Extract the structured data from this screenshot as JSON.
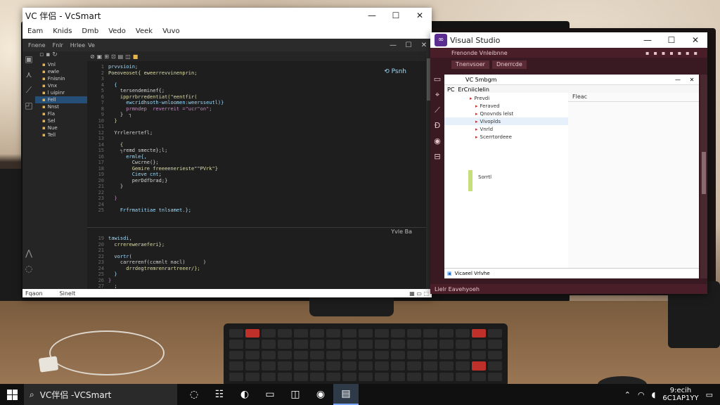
{
  "vcsmart": {
    "title": "VC 伴侣 - VcSmart",
    "menu": [
      "Eam",
      "Knids",
      "Dmb",
      "Vedo",
      "Veek",
      "Vuvo"
    ],
    "window_buttons": [
      "—",
      "☐",
      "✕"
    ],
    "ide_head": [
      "Fnene",
      "Fnlr",
      "Hrlee",
      "Ve"
    ],
    "explorer_rows": [
      {
        "label": "Vnl",
        "sel": false
      },
      {
        "label": "ewle",
        "sel": false
      },
      {
        "label": "Fnisnin",
        "sel": false
      },
      {
        "label": "Vnx",
        "sel": false
      },
      {
        "label": "l uipinr",
        "sel": false
      },
      {
        "label": "Fell",
        "sel": true
      },
      {
        "label": "Nnst",
        "sel": false
      },
      {
        "label": "Fla",
        "sel": false
      },
      {
        "label": "Sel",
        "sel": false
      },
      {
        "label": "Nue",
        "sel": false
      },
      {
        "label": "Tell",
        "sel": false
      }
    ],
    "gutter_top": [
      "1",
      "2",
      "3",
      "4",
      "5",
      "6",
      "7",
      "8",
      "9",
      "10",
      "11",
      "12",
      "13",
      "14",
      "15",
      "16",
      "17",
      "18",
      "19",
      "20",
      "21",
      "22",
      "23",
      "24",
      "25",
      "26"
    ],
    "code_lines": [
      "prvvsioin;",
      "Poeoveoset{ eweerrevvinenprin;",
      "",
      "  {",
      "    tersendeminef{;",
      "    ipprrbrredentiat(\"eentfir(",
      "      ewcridhsoth-wnloomen:weersseutl)}",
      "      prmndep  reverreit =\"ucr\"on\";",
      "    }  ┐",
      "  }",
      "",
      "  Yrrlerertefl;",
      "",
      "    {",
      "    ┐remd smecte};l;",
      "      ermle{,",
      "        Cwcrne(};",
      "        Gemire freeeenerieste\"\"PVrk\"}",
      "        Cieve cnt;",
      "        perDdfbrad;}",
      "    }",
      "",
      "  }",
      "",
      "    Frfrmatitiae tnlsamet.};"
    ],
    "search_hint": "Psnh",
    "panel_tabs": "Yvle  Ba",
    "panel_lines": [
      "tawisdi,",
      "  crrereweraeferi};",
      "",
      "  vortr(",
      "    carrerenf(ccmnlt nacl)      )",
      "      drrdegtremrenrartreeer/};",
      "  }",
      "}",
      "  ;"
    ],
    "panel_gutter": [
      "19",
      "20",
      "21",
      "22",
      "23",
      "24",
      "25",
      "26",
      "27"
    ],
    "status": [
      "Fqaon",
      "Sinelt"
    ]
  },
  "visualstudio": {
    "title": "Visual Studio",
    "subtitle": "Frenonde Vnleibnne",
    "window_buttons": [
      "—",
      "☐",
      "✕"
    ],
    "toolbar_tabs": [
      "Tnenvsoer",
      "Dnerrcde"
    ],
    "inner_title": "VC 5mbgm",
    "inner_bar": [
      "PC",
      "ErCniiclelin"
    ],
    "tree_rows": [
      {
        "label": "Prevdi",
        "sel": false
      },
      {
        "label": "Feraved",
        "sel": false
      },
      {
        "label": "Qnovnds lelst",
        "sel": false
      },
      {
        "label": "Vivoplds",
        "sel": true
      },
      {
        "label": "Vnrld",
        "sel": false
      },
      {
        "label": "Scerrtordeee",
        "sel": false
      }
    ],
    "tree_footer": "Sorrtl",
    "right_head": "Fleac",
    "inner_status": "Vicaeel Vrlvhe",
    "status": "Lielr Eavehyoeh"
  },
  "taskbar": {
    "search_text": "VC伴侣 -VCSmart",
    "apps": [
      {
        "icon": "task-view-icon",
        "glyph": "◌"
      },
      {
        "icon": "store-icon",
        "glyph": "☷"
      },
      {
        "icon": "edge-icon",
        "glyph": "◐"
      },
      {
        "icon": "folder-icon",
        "glyph": "▭"
      },
      {
        "icon": "mail-icon",
        "glyph": "◫"
      },
      {
        "icon": "chrome-icon",
        "glyph": "◉"
      },
      {
        "icon": "vcsmart-icon",
        "glyph": "▤"
      }
    ],
    "clock_time": "9:ecih",
    "clock_date": "6C1AP1YY"
  }
}
